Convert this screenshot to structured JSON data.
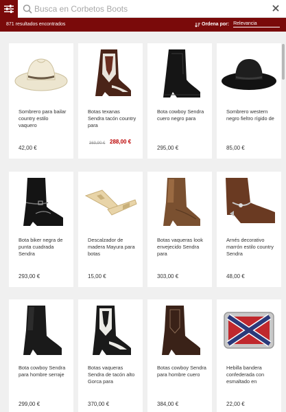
{
  "search": {
    "placeholder": "Busca en Corbetos Boots"
  },
  "results": {
    "text": "871 resultados encontrados"
  },
  "sort": {
    "label": "Ordena por:",
    "value": "Relevancia"
  },
  "colors": {
    "brand": "#7a0a0a",
    "sale": "#bb0000"
  },
  "products": [
    {
      "name": "Sombrero para bailar country estilo vaquero",
      "price": "42,00 €",
      "icon": "straw-hat"
    },
    {
      "name": "Botas texanas Sendra tacón country para",
      "old_price": "369,90 €",
      "price": "288,00 €",
      "icon": "boot-brown-white"
    },
    {
      "name": "Bota cowboy Sendra cuero negro para",
      "price": "295,00 €",
      "icon": "boot-black"
    },
    {
      "name": "Sombrero western negro fieltro rígido de",
      "price": "85,00 €",
      "icon": "black-hat"
    },
    {
      "name": "Bota biker negra de punta cuadrada Sendra",
      "price": "293,00 €",
      "icon": "biker-boot"
    },
    {
      "name": "Descalzador de madera Mayura para botas",
      "price": "15,00 €",
      "icon": "boot-jack"
    },
    {
      "name": "Botas vaqueras look envejecido Sendra para",
      "price": "303,00 €",
      "icon": "boot-brown"
    },
    {
      "name": "Arnés decorativo marrón estilo country Sendra",
      "price": "48,00 €",
      "icon": "boot-harness"
    },
    {
      "name": "Bota cowboy Sendra para hombre serraje",
      "price": "299,00 €",
      "icon": "boot-black-suede"
    },
    {
      "name": "Botas vaqueras Sendra de tacón alto Gorca para",
      "price": "370,00 €",
      "icon": "boot-black-white"
    },
    {
      "name": "Botas cowboy Sendra para hombre cuero",
      "price": "384,00 €",
      "icon": "boot-brown-dark"
    },
    {
      "name": "Hebilla bandera confederada con esmaltado en",
      "price": "22,00 €",
      "icon": "buckle-flag"
    }
  ]
}
